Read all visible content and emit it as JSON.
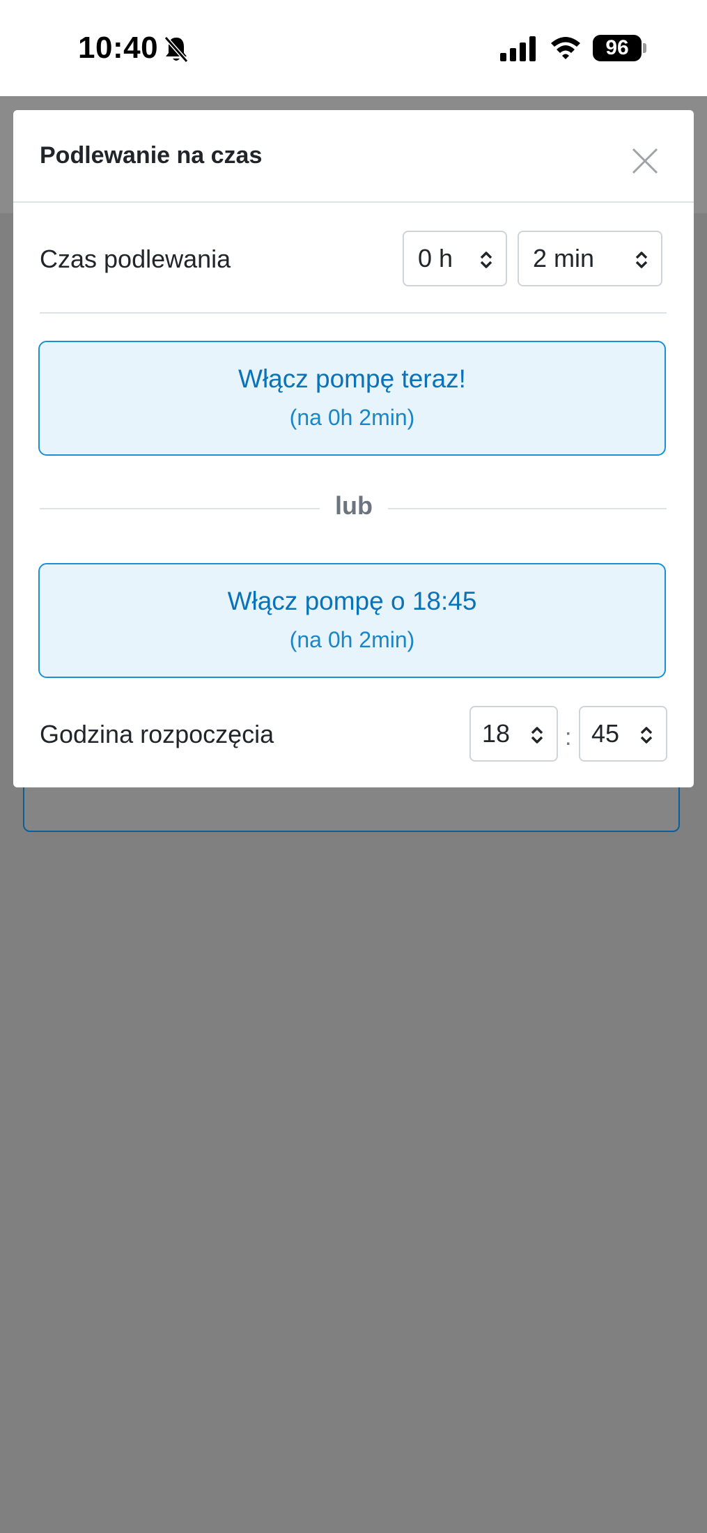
{
  "status_bar": {
    "time": "10:40",
    "battery": "96",
    "icons": [
      "bell-slash-icon",
      "cellular-signal-icon",
      "wifi-icon",
      "battery-icon"
    ]
  },
  "modal": {
    "title": "Podlewanie na czas",
    "close_icon": "close-icon",
    "duration": {
      "label": "Czas podlewania",
      "hours": "0 h",
      "minutes": "2 min"
    },
    "pump_now": {
      "label": "Włącz pompę teraz!",
      "sub": "(na 0h 2min)"
    },
    "or_text": "lub",
    "pump_scheduled": {
      "label": "Włącz pompę o 18:45",
      "sub": "(na 0h 2min)"
    },
    "start_time": {
      "label": "Godzina rozpoczęcia",
      "hour": "18",
      "separator": ":",
      "minute": "45"
    }
  },
  "colors": {
    "accent": "#0b72b8",
    "button_bg": "#e7f4fc",
    "button_border": "#1a8fd4",
    "backdrop": "#808080"
  }
}
